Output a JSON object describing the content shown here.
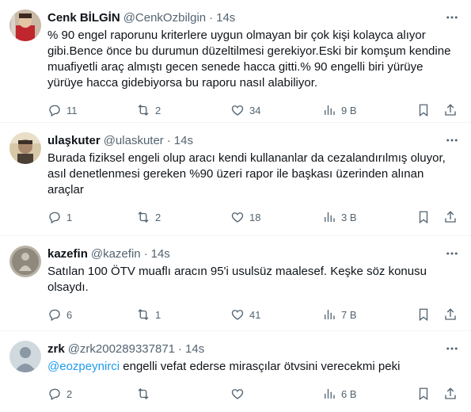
{
  "tweets": [
    {
      "name": "Cenk BİLGİN",
      "handle": "@CenkOzbilgin",
      "dot": "·",
      "time": "14s",
      "text": "% 90 engel raporunu kriterlere uygun olmayan bir çok kişi kolayca alıyor gibi.Bence önce bu durumun düzeltilmesi gerekiyor.Eski bir komşum kendine muafiyetli araç almıştı gecen senede hacca gitti.% 90 engelli biri yürüye yürüye hacca gidebiyorsa bu raporu nasıl alabiliyor.",
      "replies": "11",
      "retweets": "2",
      "likes": "34",
      "views": "9 B"
    },
    {
      "name": "ulaşkuter",
      "handle": "@ulaskuter",
      "dot": "·",
      "time": "14s",
      "text": "Burada fiziksel engeli olup aracı kendi kullananlar da cezalandırılmış oluyor, asıl denetlenmesi gereken %90 üzeri rapor ile başkası üzerinden alınan araçlar",
      "replies": "1",
      "retweets": "2",
      "likes": "18",
      "views": "3 B"
    },
    {
      "name": "kazefin",
      "handle": "@kazefin",
      "dot": "·",
      "time": "14s",
      "text": "Satılan 100 ÖTV muaflı aracın 95'i usulsüz maalesef. Keşke söz konusu olsaydı.",
      "replies": "6",
      "retweets": "1",
      "likes": "41",
      "views": "7 B"
    },
    {
      "name": "zrk",
      "handle": "@zrk200289337871",
      "dot": "·",
      "time": "14s",
      "mention": "@eozpeynirci",
      "text": " engelli vefat ederse mirasçılar ötvsini  verecekmi peki",
      "replies": "2",
      "retweets": "",
      "likes": "",
      "views": "6 B"
    }
  ],
  "colors": {
    "text": "#0f1419",
    "secondary": "#536471",
    "link": "#1d9bf0",
    "divider": "#eff3f4"
  },
  "icons": [
    "reply-icon",
    "retweet-icon",
    "like-icon",
    "views-icon",
    "bookmark-icon",
    "share-icon",
    "more-icon"
  ]
}
